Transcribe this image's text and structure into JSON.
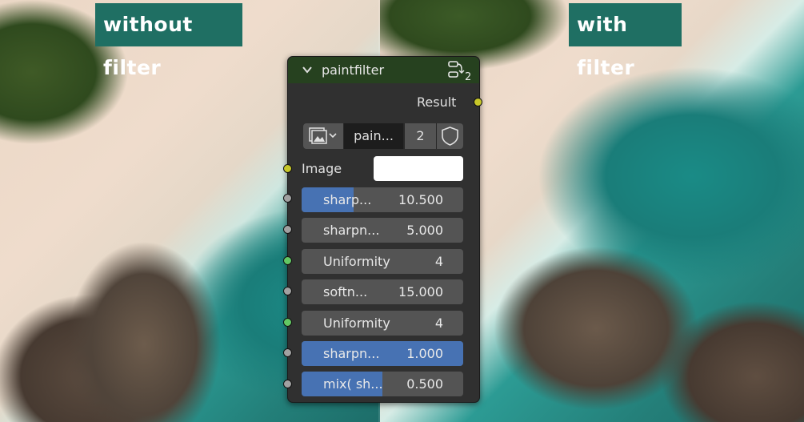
{
  "captions": {
    "left": "without filter",
    "right": "with filter"
  },
  "node": {
    "title": "paintfilter",
    "group_user_count": "2",
    "output": {
      "label": "Result"
    },
    "datablock": {
      "name": "pain...",
      "users": "2"
    },
    "image_input": {
      "label": "Image",
      "color": "#ffffff"
    },
    "fields": [
      {
        "label": "sharp...",
        "value": "10.500",
        "fill": 0.32
      },
      {
        "label": "sharpn...",
        "value": "5.000",
        "fill": 0
      },
      {
        "label": "Uniformity",
        "value": "4",
        "fill": 0
      },
      {
        "label": "softn...",
        "value": "15.000",
        "fill": 0
      },
      {
        "label": "Uniformity",
        "value": "4",
        "fill": 0
      },
      {
        "label": "sharpn...",
        "value": "1.000",
        "fill": 1.0
      },
      {
        "label": "mix( sh...",
        "value": "0.500",
        "fill": 0.5
      }
    ]
  },
  "colors": {
    "node_header": "#26411f",
    "node_body": "#303030",
    "slider_fill": "#4772b3",
    "socket_color": "#c7c729",
    "socket_float": "#a1a1a1",
    "socket_int": "#63c763",
    "caption_bg": "#1f6f63"
  }
}
